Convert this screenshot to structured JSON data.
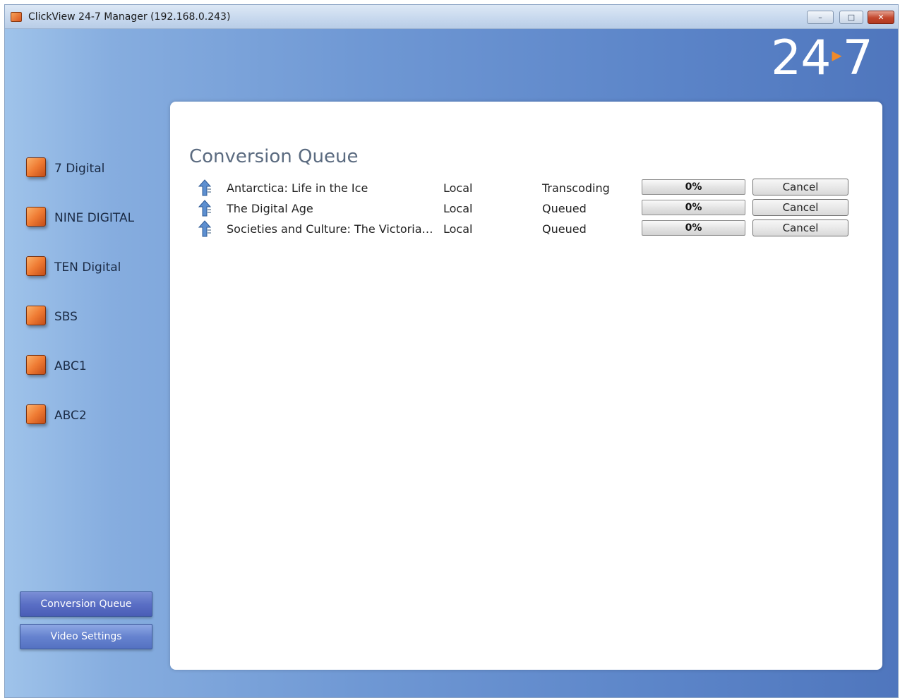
{
  "window": {
    "title": "ClickView 24-7 Manager (192.168.0.243)",
    "buttons": {
      "minimize": "–",
      "maximize": "□",
      "close": "✕"
    }
  },
  "brand": {
    "left": "24",
    "arrow": "▸",
    "right": "7"
  },
  "channels": [
    {
      "label": "7 Digital"
    },
    {
      "label": "NINE DIGITAL"
    },
    {
      "label": "TEN Digital"
    },
    {
      "label": "SBS"
    },
    {
      "label": "ABC1"
    },
    {
      "label": "ABC2"
    }
  ],
  "nav": {
    "conversion_queue": "Conversion Queue",
    "video_settings": "Video Settings",
    "active": "conversion_queue"
  },
  "main": {
    "title": "Conversion Queue",
    "queue": [
      {
        "title": "Antarctica: Life in the Ice",
        "location": "Local",
        "status": "Transcoding",
        "progress_pct": 0,
        "progress_label": "0%",
        "action": "Cancel",
        "icon": "upload-arrow-icon"
      },
      {
        "title": "The Digital Age",
        "location": "Local",
        "status": "Queued",
        "progress_pct": 0,
        "progress_label": "0%",
        "action": "Cancel",
        "icon": "upload-arrow-icon"
      },
      {
        "title": "Societies and Culture: The Victorian...",
        "location": "Local",
        "status": "Queued",
        "progress_pct": 0,
        "progress_label": "0%",
        "action": "Cancel",
        "icon": "upload-arrow-icon"
      }
    ]
  },
  "colors": {
    "brand_arrow": "#f08a2a",
    "progress_fill": "#4fa64f"
  }
}
